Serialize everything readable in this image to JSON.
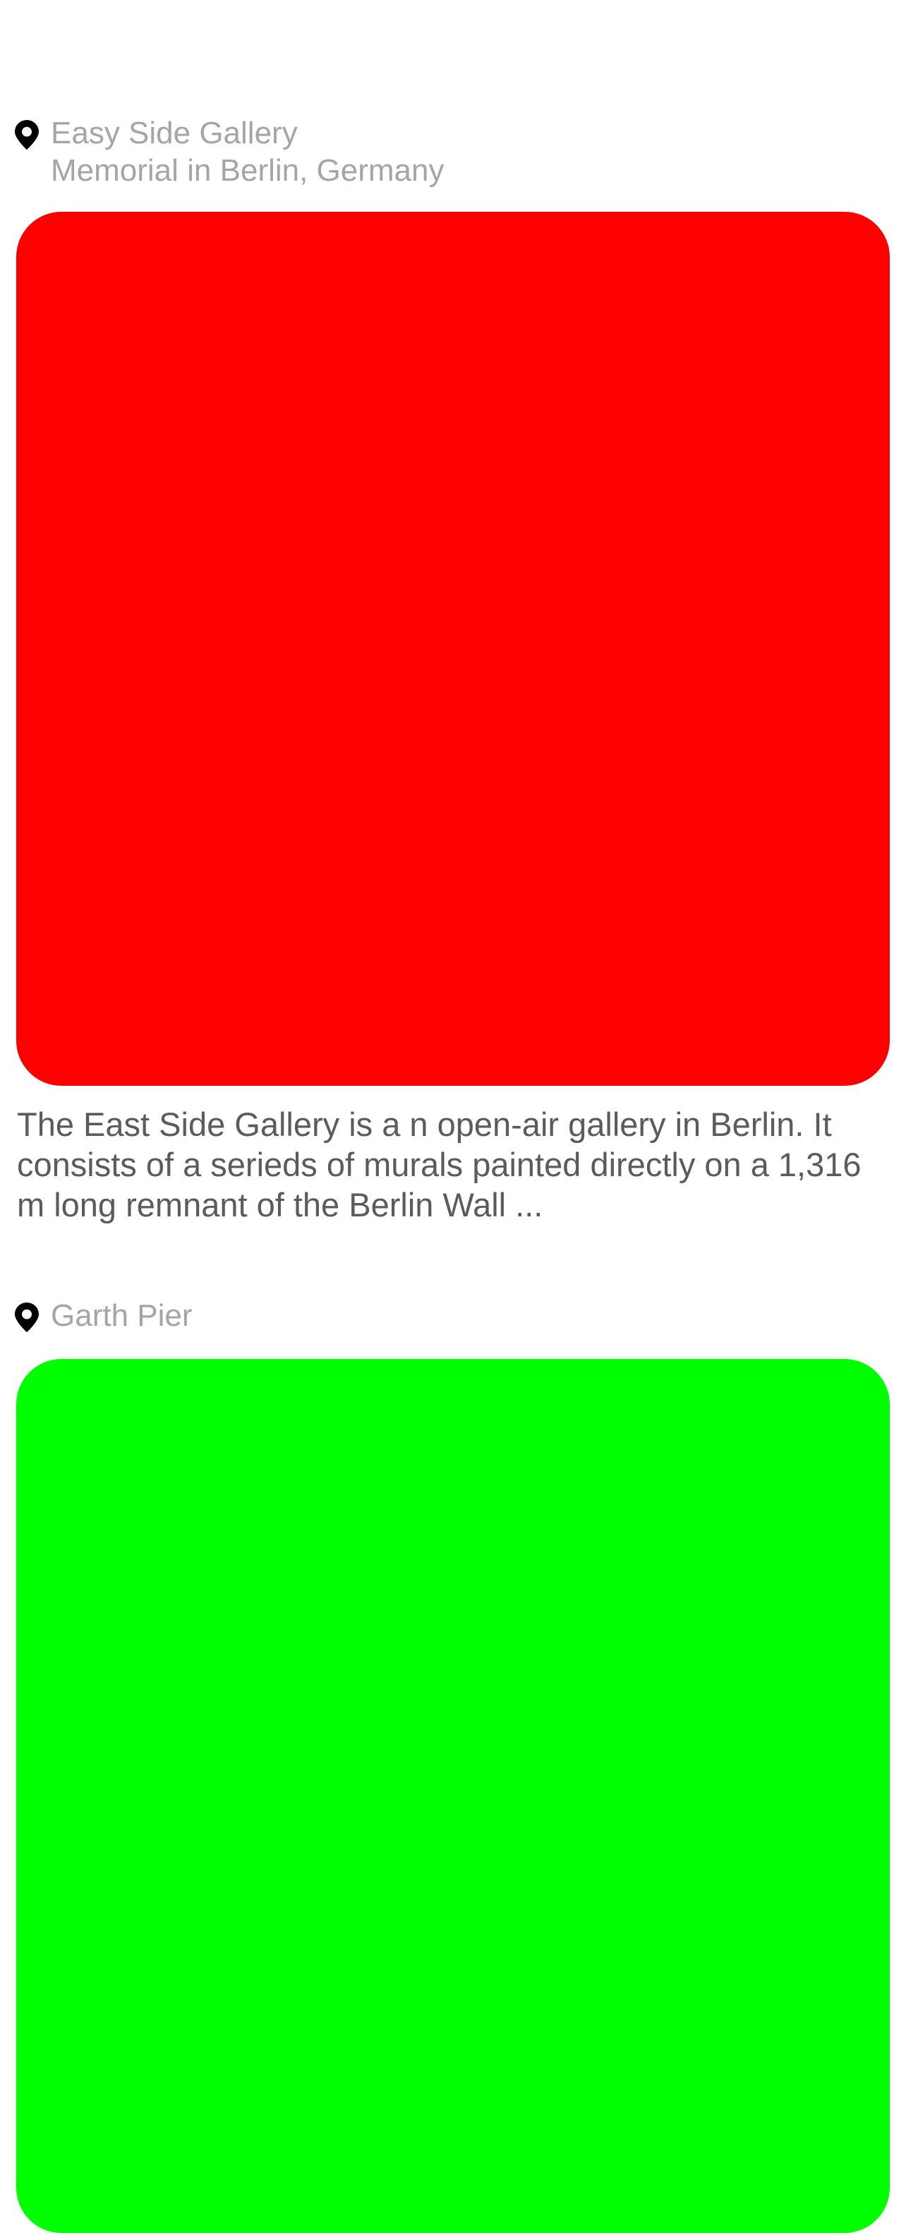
{
  "posts": [
    {
      "place": "Easy Side Gallery",
      "subtitle": "Memorial in Berlin, Germany",
      "photo_color": "#fe0000",
      "description": "The East Side Gallery is a n open-air gallery in Berlin. It consists of a serieds of murals painted directly on a 1,316 m long remnant of the Berlin Wall ...",
      "icon": "map-pin-icon"
    },
    {
      "place": "Garth Pier",
      "photo_color": "#00ff00",
      "icon": "map-pin-icon"
    }
  ]
}
